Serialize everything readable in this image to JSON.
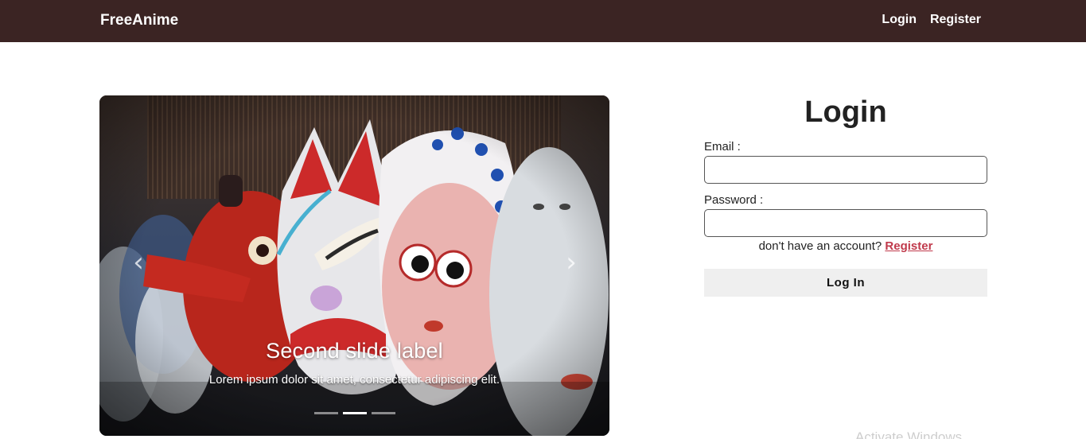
{
  "navbar": {
    "brand": "FreeAnime",
    "links": {
      "login": "Login",
      "register": "Register"
    }
  },
  "carousel": {
    "caption_title": "Second slide label",
    "caption_text": "Lorem ipsum dolor sit amet, consectetur adipiscing elit.",
    "prev_glyph": "‹",
    "next_glyph": "›",
    "indicator_count": 3,
    "active_index": 1
  },
  "login": {
    "title": "Login",
    "email_label": "Email :",
    "email_value": "",
    "password_label": "Password :",
    "password_value": "",
    "no_account_text": "don't have an account? ",
    "register_link": "Register",
    "submit_label": "Log In"
  },
  "watermark": "Activate Windows",
  "colors": {
    "navbar_bg": "#3b2423",
    "link_accent": "#c0394b",
    "button_bg": "#efefef"
  }
}
